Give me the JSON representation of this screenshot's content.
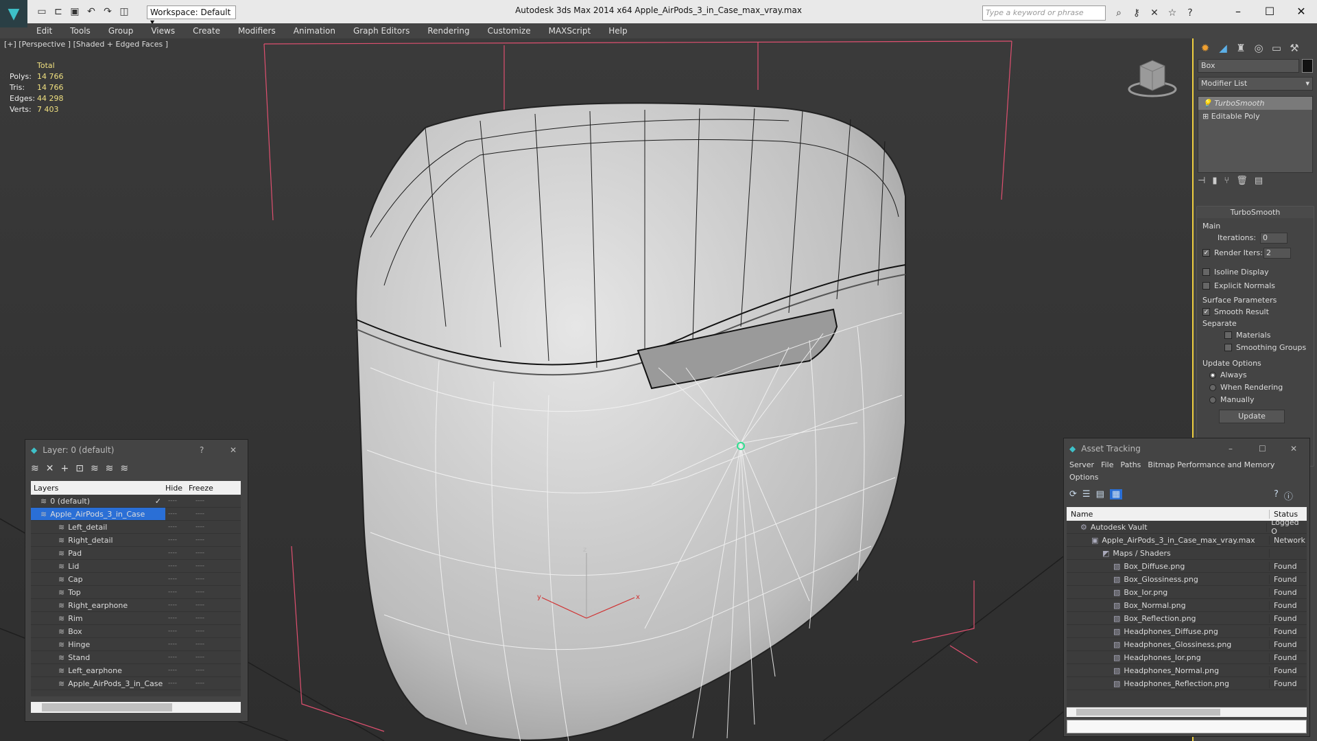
{
  "app": {
    "title": "Autodesk 3ds Max  2014 x64     Apple_AirPods_3_in_Case_max_vray.max",
    "workspace": "Workspace: Default",
    "search_placeholder": "Type a keyword or phrase"
  },
  "menu": [
    "Edit",
    "Tools",
    "Group",
    "Views",
    "Create",
    "Modifiers",
    "Animation",
    "Graph Editors",
    "Rendering",
    "Customize",
    "MAXScript",
    "Help"
  ],
  "viewport": {
    "label": "[+] [Perspective ] [Shaded + Edged Faces ]",
    "stats": {
      "header": "Total",
      "rows": [
        {
          "k": "Polys:",
          "v": "14 766"
        },
        {
          "k": "Tris:",
          "v": "14 766"
        },
        {
          "k": "Edges:",
          "v": "44 298"
        },
        {
          "k": "Verts:",
          "v": "7 403"
        }
      ]
    },
    "axis": {
      "x": "x",
      "y": "y",
      "z": "z"
    }
  },
  "command_panel": {
    "object_name": "Box",
    "modifier_list": "Modifier List",
    "stack": [
      "TurboSmooth",
      "Editable Poly"
    ],
    "rollout": "TurboSmooth",
    "main": "Main",
    "iterations_label": "Iterations:",
    "iterations": "0",
    "render_iters_label": "Render Iters:",
    "render_iters": "2",
    "isoline": "Isoline Display",
    "explicit": "Explicit Normals",
    "surface": "Surface Parameters",
    "smooth_result": "Smooth Result",
    "separate": "Separate",
    "materials": "Materials",
    "smoothing_groups": "Smoothing Groups",
    "update_options": "Update Options",
    "always": "Always",
    "when_rendering": "When Rendering",
    "manually": "Manually",
    "update_btn": "Update"
  },
  "layer_panel": {
    "title": "Layer: 0 (default)",
    "help": "?",
    "close": "✕",
    "cols": {
      "layers": "Layers",
      "hide": "Hide",
      "freeze": "Freeze"
    },
    "rows": [
      "0 (default)",
      "Apple_AirPods_3_in_Case",
      "Left_detail",
      "Right_detail",
      "Pad",
      "Lid",
      "Cap",
      "Top",
      "Right_earphone",
      "Rim",
      "Box",
      "Hinge",
      "Stand",
      "Left_earphone",
      "Apple_AirPods_3_in_Case"
    ],
    "dash": "----",
    "check": "✓"
  },
  "asset_panel": {
    "title": "Asset Tracking",
    "menu": [
      "Server",
      "File",
      "Paths",
      "Bitmap Performance and Memory"
    ],
    "menu2": "Options",
    "cols": {
      "name": "Name",
      "status": "Status"
    },
    "rows": [
      {
        "name": "Autodesk Vault",
        "status": "Logged O",
        "level": 0
      },
      {
        "name": "Apple_AirPods_3_in_Case_max_vray.max",
        "status": "Network",
        "level": 1
      },
      {
        "name": "Maps / Shaders",
        "status": "",
        "level": 2
      },
      {
        "name": "Box_Diffuse.png",
        "status": "Found",
        "level": 3
      },
      {
        "name": "Box_Glossiness.png",
        "status": "Found",
        "level": 3
      },
      {
        "name": "Box_Ior.png",
        "status": "Found",
        "level": 3
      },
      {
        "name": "Box_Normal.png",
        "status": "Found",
        "level": 3
      },
      {
        "name": "Box_Reflection.png",
        "status": "Found",
        "level": 3
      },
      {
        "name": "Headphones_Diffuse.png",
        "status": "Found",
        "level": 3
      },
      {
        "name": "Headphones_Glossiness.png",
        "status": "Found",
        "level": 3
      },
      {
        "name": "Headphones_Ior.png",
        "status": "Found",
        "level": 3
      },
      {
        "name": "Headphones_Normal.png",
        "status": "Found",
        "level": 3
      },
      {
        "name": "Headphones_Reflection.png",
        "status": "Found",
        "level": 3
      }
    ]
  },
  "colors": {
    "accent": "#f0d040",
    "selection": "#2a6fd6",
    "bbox": "#e05070"
  }
}
